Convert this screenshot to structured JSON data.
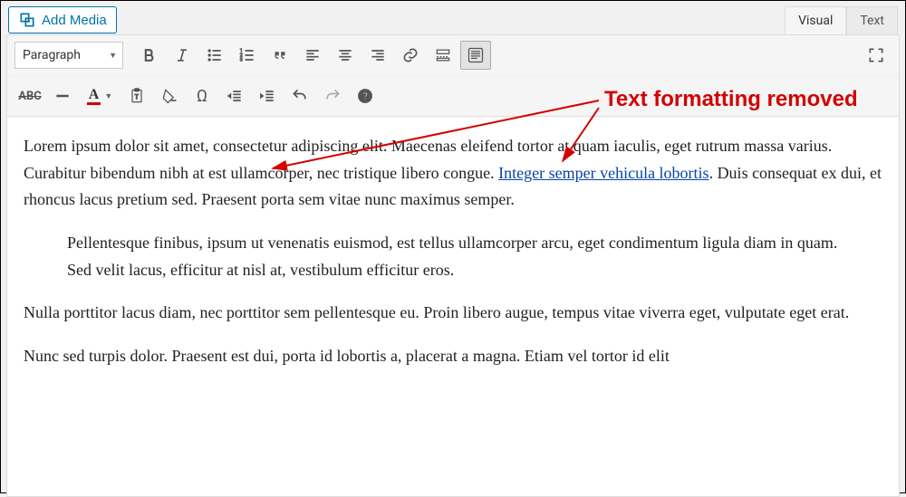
{
  "add_media_label": "Add Media",
  "tabs": {
    "visual": "Visual",
    "text": "Text"
  },
  "format_selected": "Paragraph",
  "annotation": "Text formatting removed",
  "content": {
    "p1_before": "Lorem ipsum dolor sit amet, consectetur adipiscing elit. Maecenas eleifend tortor at quam iaculis, eget rutrum massa varius. Curabitur bibendum nibh at est ullamcorper, nec tristique libero congue. ",
    "p1_link": "Integer semper vehicula lobortis",
    "p1_after": ". Duis consequat ex dui, et rhoncus lacus pretium sed. Praesent porta sem vitae nunc maximus semper.",
    "p2": "Pellentesque finibus, ipsum ut venenatis euismod, est tellus ullamcorper arcu, eget condimentum ligula diam in quam. Sed velit lacus, efficitur at nisl at, vestibulum efficitur eros.",
    "p3": "Nulla porttitor lacus diam, nec porttitor sem pellentesque eu. Proin libero augue, tempus vitae viverra eget, vulputate eget erat.",
    "p4": "Nunc sed turpis dolor. Praesent est dui, porta id lobortis a, placerat a magna. Etiam vel tortor id elit"
  }
}
